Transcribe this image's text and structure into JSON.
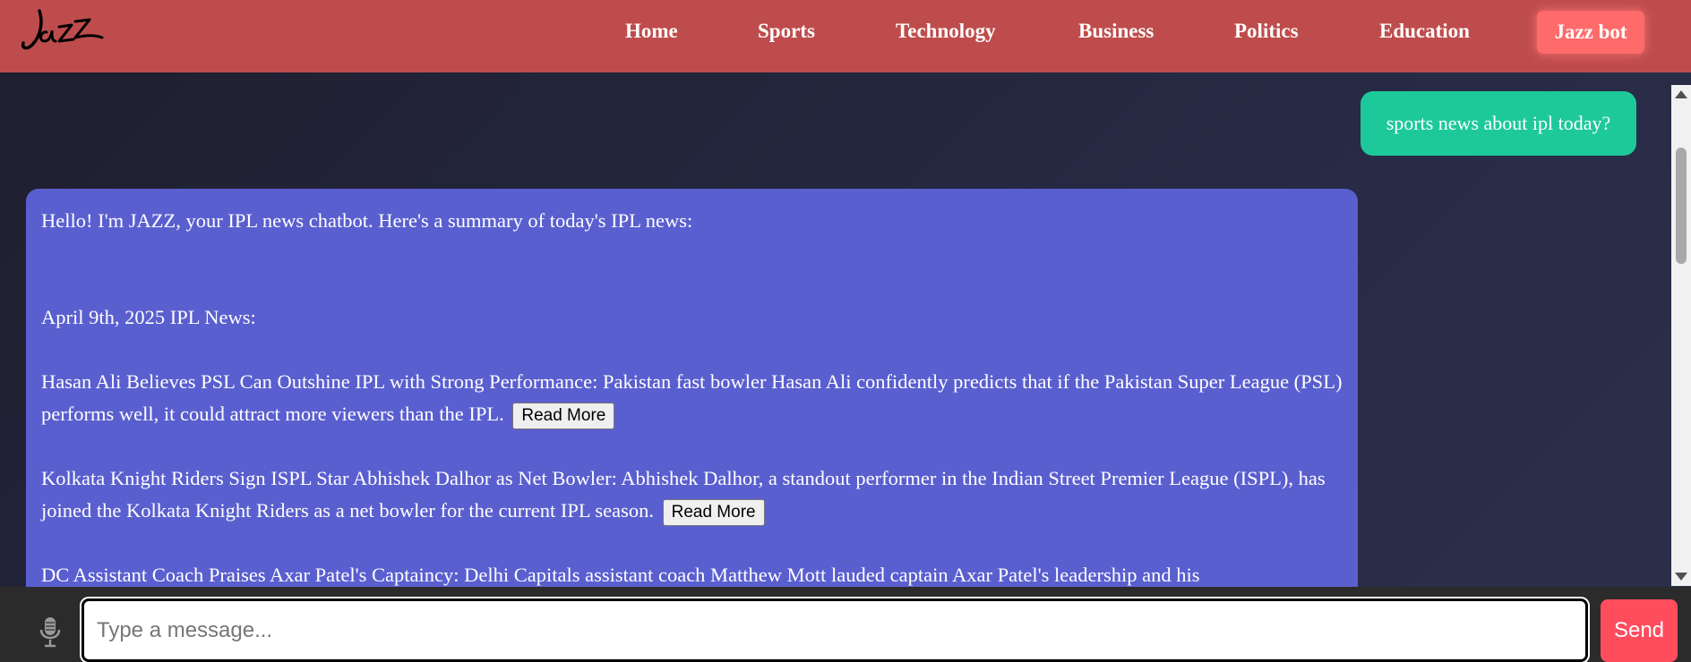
{
  "navbar": {
    "logo_text": "Jazz",
    "links": {
      "home": "Home",
      "sports": "Sports",
      "technology": "Technology",
      "business": "Business",
      "politics": "Politics",
      "education": "Education",
      "bot": "Jazz bot"
    },
    "colors": {
      "background": "#bf4c4c",
      "bot_button": "#ff6b6b"
    }
  },
  "chat": {
    "user_message": "sports news about ipl today?",
    "bot_message": {
      "intro": "Hello! I'm JAZZ, your IPL news chatbot. Here's a summary of today's IPL news:",
      "date_heading": "April 9th, 2025 IPL News:",
      "news": [
        {
          "text": "Hasan Ali Believes PSL Can Outshine IPL with Strong Performance: Pakistan fast bowler Hasan Ali confidently predicts that if the Pakistan Super League (PSL) performs well, it could attract more viewers than the IPL.",
          "button": "Read More"
        },
        {
          "text": "Kolkata Knight Riders Sign ISPL Star Abhishek Dalhor as Net Bowler: Abhishek Dalhor, a standout performer in the Indian Street Premier League (ISPL), has joined the Kolkata Knight Riders as a net bowler for the current IPL season.",
          "button": "Read More"
        },
        {
          "text": "DC Assistant Coach Praises Axar Patel's Captaincy: Delhi Capitals assistant coach Matthew Mott lauded captain Axar Patel's leadership and his"
        }
      ]
    },
    "colors": {
      "user_bubble": "#1dc99a",
      "bot_bubble": "#5a5fcf"
    }
  },
  "input": {
    "placeholder": "Type a message...",
    "value": "",
    "send_label": "Send",
    "mic_icon": "microphone-icon",
    "send_color": "#ff4d5e"
  }
}
